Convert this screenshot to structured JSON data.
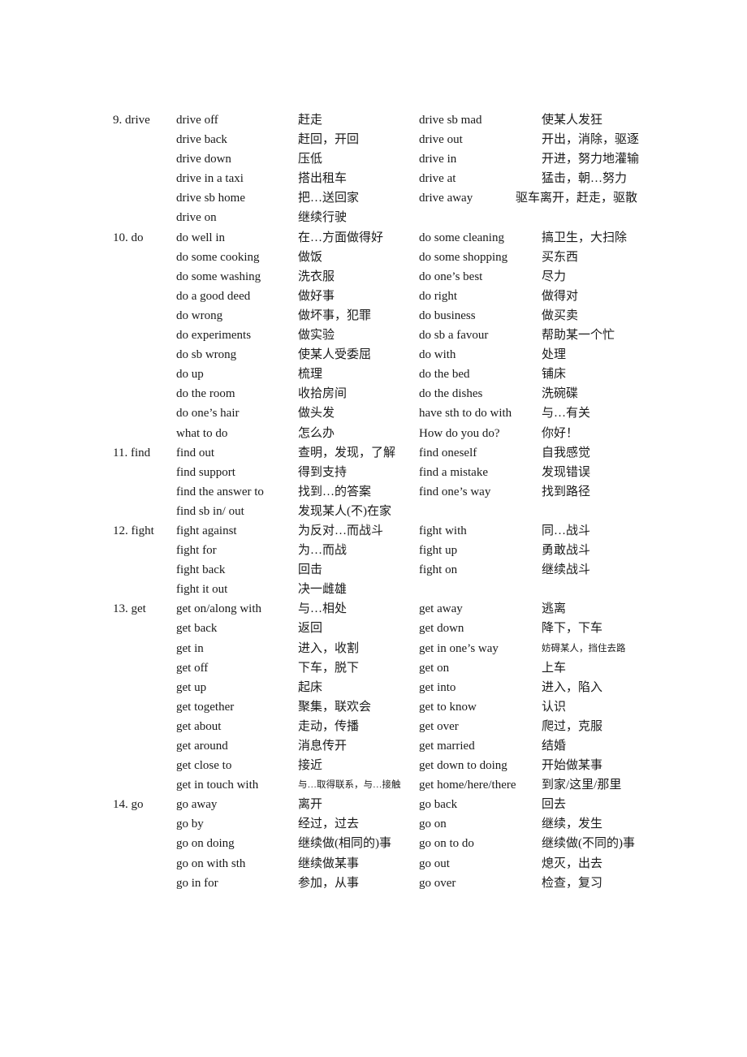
{
  "document": {
    "sections": [
      {
        "headword": "9. drive",
        "rows": [
          {
            "p1": "drive off",
            "m1": "赶走",
            "p2": "drive sb mad",
            "m2": "使某人发狂"
          },
          {
            "p1": "drive back",
            "m1": "赶回，开回",
            "p2": "drive out",
            "m2": "开出，消除，驱逐"
          },
          {
            "p1": "drive down",
            "m1": "压低",
            "p2": "drive in",
            "m2": "开进，努力地灌输"
          },
          {
            "p1": "drive in a taxi",
            "m1": "搭出租车",
            "p2": "drive at",
            "m2": "猛击，朝…努力"
          },
          {
            "p1": "drive sb home",
            "m1": "把…送回家",
            "p2": "drive away",
            "m2": "驱车离开，赶走，驱散",
            "m2_wide": true
          },
          {
            "p1": "drive on",
            "m1": "继续行驶",
            "p2": "",
            "m2": ""
          }
        ]
      },
      {
        "headword": "10. do",
        "rows": [
          {
            "p1": "do well in",
            "m1": "在…方面做得好",
            "p2": "do some cleaning",
            "m2": "搞卫生，大扫除"
          },
          {
            "p1": "do some cooking",
            "m1": "做饭",
            "p2": "do some shopping",
            "m2": "买东西"
          },
          {
            "p1": "do some washing",
            "m1": "洗衣服",
            "p2": "do one’s best",
            "m2": "尽力"
          },
          {
            "p1": "do a good deed",
            "m1": "做好事",
            "p2": "do right",
            "m2": "做得对"
          },
          {
            "p1": "do wrong",
            "m1": "做坏事，犯罪",
            "p2": "do business",
            "m2": "做买卖"
          },
          {
            "p1": "do experiments",
            "m1": "做实验",
            "p2": "do sb a favour",
            "m2": "帮助某一个忙"
          },
          {
            "p1": "do sb wrong",
            "m1": "使某人受委屈",
            "p2": "do with",
            "m2": "处理"
          },
          {
            "p1": "do up",
            "m1": "梳理",
            "p2": "do the bed",
            "m2": "铺床"
          },
          {
            "p1": "do the room",
            "m1": "收拾房间",
            "p2": "do the dishes",
            "m2": "洗碗碟"
          },
          {
            "p1": "do one’s hair",
            "m1": "做头发",
            "p2": "have sth to do with",
            "m2": "与…有关"
          },
          {
            "p1": "what to do",
            "m1": "怎么办",
            "p2": "How do you do?",
            "m2": "你好！"
          }
        ]
      },
      {
        "headword": "11. find",
        "rows": [
          {
            "p1": "find out",
            "m1": "查明，发现，了解",
            "p2": "find oneself",
            "m2": "自我感觉"
          },
          {
            "p1": "find support",
            "m1": "得到支持",
            "p2": "find a mistake",
            "m2": "发现错误"
          },
          {
            "p1": "find the answer to",
            "m1": "找到…的答案",
            "p2": "find one’s way",
            "m2": "找到路径"
          },
          {
            "p1": "find sb in/ out",
            "m1": "发现某人(不)在家",
            "p2": "",
            "m2": ""
          }
        ]
      },
      {
        "headword": "12. fight",
        "rows": [
          {
            "p1": "fight against",
            "m1": "为反对…而战斗",
            "p2": "fight with",
            "m2": "同…战斗"
          },
          {
            "p1": "fight for",
            "m1": "为…而战",
            "p2": "fight up",
            "m2": "勇敢战斗"
          },
          {
            "p1": "fight back",
            "m1": "回击",
            "p2": "fight on",
            "m2": "继续战斗"
          },
          {
            "p1": "fight it out",
            "m1": "决一雌雄",
            "p2": "",
            "m2": ""
          }
        ]
      },
      {
        "headword": "13. get",
        "rows": [
          {
            "p1": "get on/along with",
            "m1": "与…相处",
            "p2": "get away",
            "m2": "逃离"
          },
          {
            "p1": "get back",
            "m1": "返回",
            "p2": "get down",
            "m2": "降下，下车"
          },
          {
            "p1": "get in",
            "m1": "进入，收割",
            "p2": "get in one’s way",
            "m2": "妨碍某人，挡住去路",
            "m2_small": true
          },
          {
            "p1": "get off",
            "m1": "下车，脱下",
            "p2": "get on",
            "m2": "上车"
          },
          {
            "p1": "get up",
            "m1": "起床",
            "p2": "get into",
            "m2": "进入，陷入"
          },
          {
            "p1": "get together",
            "m1": "聚集，联欢会",
            "p2": "get to know",
            "m2": "认识"
          },
          {
            "p1": "get about",
            "m1": "走动，传播",
            "p2": "get over",
            "m2": "爬过，克服"
          },
          {
            "p1": "get around",
            "m1": "消息传开",
            "p2": "get married",
            "m2": "结婚"
          },
          {
            "p1": "get close to",
            "m1": "接近",
            "p2": "get down to doing",
            "m2": "开始做某事"
          },
          {
            "p1": "get in touch with",
            "m1": "与…取得联系，与…接触",
            "m1_small": true,
            "p2": "get home/here/there",
            "m2": "到家/这里/那里"
          }
        ]
      },
      {
        "headword": "14. go",
        "rows": [
          {
            "p1": "go away",
            "m1": "离开",
            "p2": "go back",
            "m2": "回去"
          },
          {
            "p1": "go by",
            "m1": "经过，过去",
            "p2": "go on",
            "m2": "继续，发生"
          },
          {
            "p1": "go on doing",
            "m1": "继续做(相同的)事",
            "p2": "go on to do",
            "m2": "继续做(不同的)事"
          },
          {
            "p1": "go on with sth",
            "m1": "继续做某事",
            "p2": "go out",
            "m2": "熄灭，出去"
          },
          {
            "p1": "go in for",
            "m1": "参加，从事",
            "p2": "go over",
            "m2": "检查，复习"
          }
        ]
      }
    ]
  }
}
